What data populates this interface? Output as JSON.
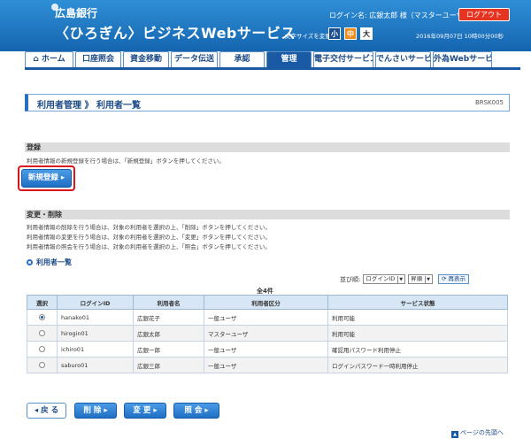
{
  "header": {
    "bank_name": "広島銀行",
    "service_name": "〈ひろぎん〉ビジネスWebサービス",
    "login_info": "ログイン名: 広銀太郎 様（マスターユーザ）",
    "logout_label": "ログアウト",
    "font_size_label": "文字サイズを変更",
    "font_small": "小",
    "font_medium": "中",
    "font_large": "大",
    "datetime": "2016年09月07日 10時00分00秒"
  },
  "nav": [
    {
      "label": "ホーム",
      "active": false,
      "width": 55
    },
    {
      "label": "口座照会",
      "active": false,
      "width": 52
    },
    {
      "label": "資金移動",
      "active": false,
      "width": 52
    },
    {
      "label": "データ伝送",
      "active": false,
      "width": 53
    },
    {
      "label": "承認",
      "active": false,
      "width": 51
    },
    {
      "label": "管理",
      "active": true,
      "width": 51
    },
    {
      "label": "電子交付サービス",
      "active": false,
      "width": 68
    },
    {
      "label": "でんさいサービス",
      "active": false,
      "width": 63
    },
    {
      "label": "外為Webサービス",
      "active": false,
      "width": 67
    }
  ],
  "page": {
    "title": "利用者管理 》 利用者一覧",
    "code": "BRSK005"
  },
  "register": {
    "heading": "登録",
    "description": "利用者情報の新規登録を行う場合は、「新規登録」ボタンを押してください。",
    "button_label": "新規登録 ▸"
  },
  "modify": {
    "heading": "変更・削除",
    "lines": [
      "利用者情報の削除を行う場合は、対象の利用者を選択の上、「削除」ボタンを押してください。",
      "利用者情報の変更を行う場合は、対象の利用者を選択の上、「変更」ボタンを押してください。",
      "利用者情報の照会を行う場合は、対象の利用者を選択の上、「照会」ボタンを押してください。"
    ]
  },
  "list": {
    "title": "利用者一覧",
    "sort_label": "並び順:",
    "sort_field": "ログインID",
    "sort_order": "昇順",
    "redisplay_label": "再表示",
    "count": "全4件",
    "columns": [
      "選択",
      "ログインID",
      "利用者名",
      "利用者区分",
      "サービス状態"
    ],
    "rows": [
      {
        "selected": true,
        "login_id": "hanako01",
        "name": "広銀花子",
        "type": "一般ユーザ",
        "status": "利用可能"
      },
      {
        "selected": false,
        "login_id": "hirogin01",
        "name": "広銀太郎",
        "type": "マスターユーザ",
        "status": "利用可能"
      },
      {
        "selected": false,
        "login_id": "ichiro01",
        "name": "広銀一郎",
        "type": "一般ユーザ",
        "status": "確認用パスワード利用停止"
      },
      {
        "selected": false,
        "login_id": "saburo01",
        "name": "広銀三郎",
        "type": "一般ユーザ",
        "status": "ログインパスワード一時利用停止"
      }
    ]
  },
  "buttons": {
    "back": "◂ 戻 る",
    "delete": "削 除 ▸",
    "change": "変 更 ▸",
    "view": "照 会 ▸"
  },
  "page_top": "ページの先頭へ",
  "colors": {
    "header": "#1565b0",
    "accent": "#1a5aa5",
    "logout": "#e53421",
    "highlight": "#d9151c"
  }
}
